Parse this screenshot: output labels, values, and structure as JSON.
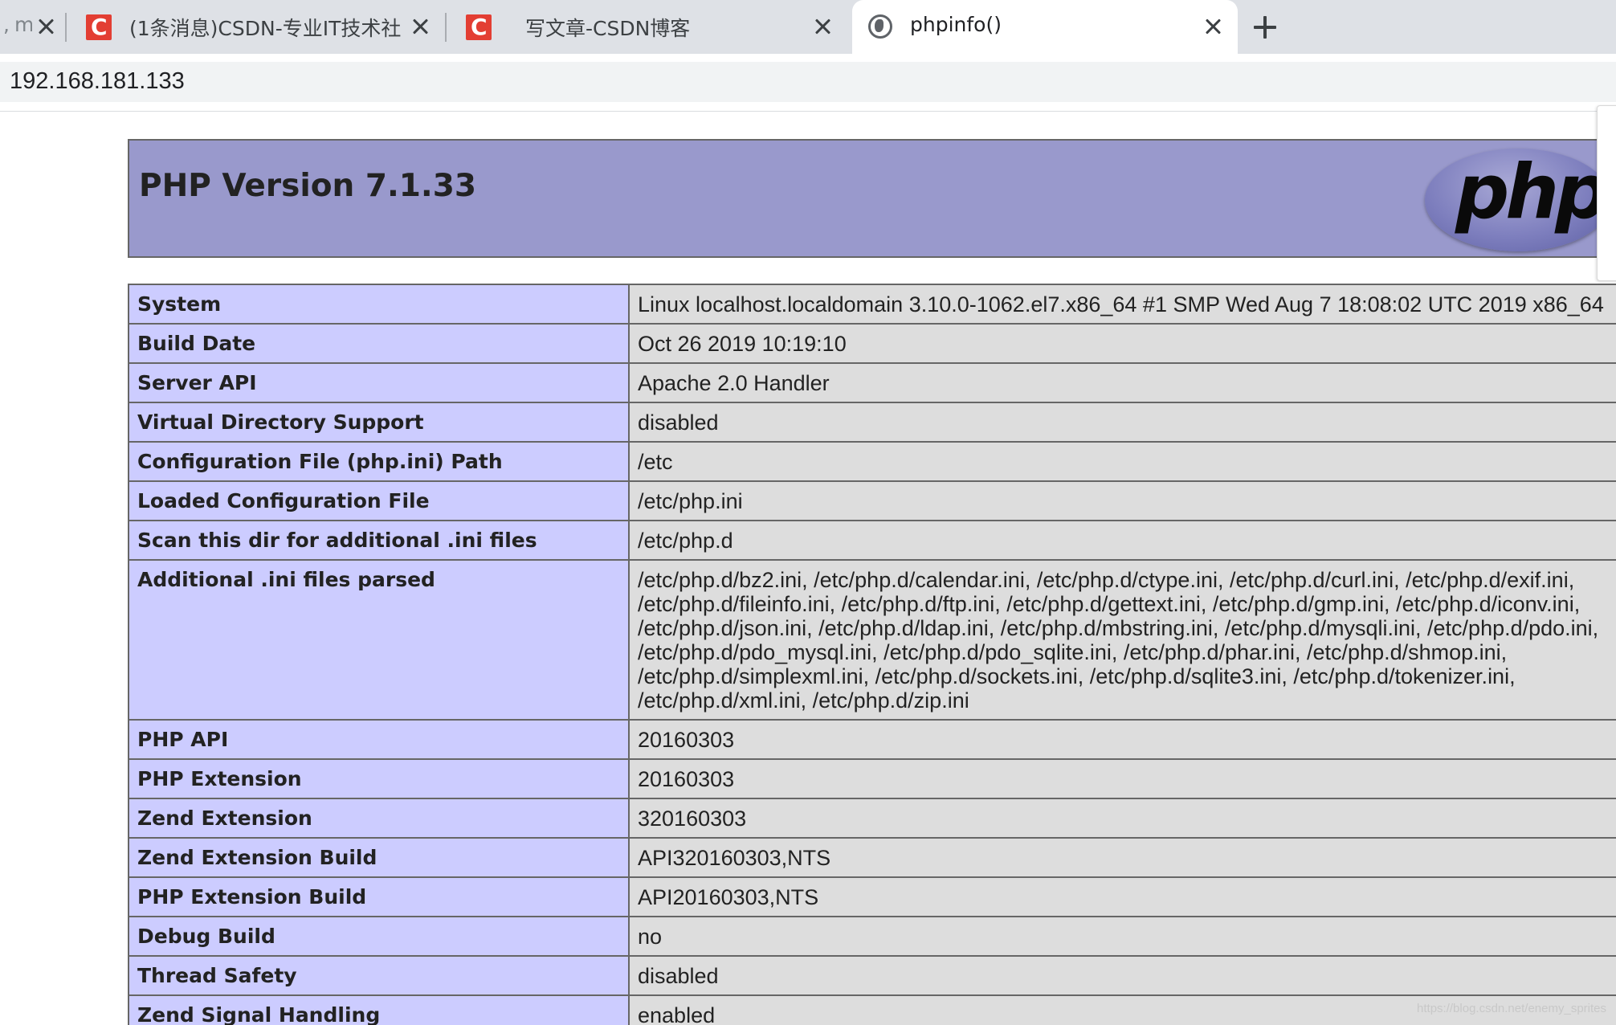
{
  "browser": {
    "tabs": [
      {
        "title": "ma",
        "active": false
      },
      {
        "title": "(1条消息)CSDN-专业IT技术社区",
        "active": false
      },
      {
        "title": "写文章-CSDN博客",
        "active": false
      },
      {
        "title": "phpinfo()",
        "active": true
      }
    ],
    "address": "192.168.181.133"
  },
  "page": {
    "title": "PHP Version 7.1.33",
    "logo_text": "php",
    "rows": [
      {
        "key": "System",
        "value": [
          "Linux localhost.localdomain 3.10.0-1062.el7.x86_64 #1 SMP Wed Aug 7 18:08:02 UTC 2019 x86_64"
        ]
      },
      {
        "key": "Build Date",
        "value": [
          "Oct 26 2019 10:19:10"
        ]
      },
      {
        "key": "Server API",
        "value": [
          "Apache 2.0 Handler"
        ]
      },
      {
        "key": "Virtual Directory Support",
        "value": [
          "disabled"
        ]
      },
      {
        "key": "Configuration File (php.ini) Path",
        "value": [
          "/etc"
        ]
      },
      {
        "key": "Loaded Configuration File",
        "value": [
          "/etc/php.ini"
        ]
      },
      {
        "key": "Scan this dir for additional .ini files",
        "value": [
          "/etc/php.d"
        ]
      },
      {
        "key": "Additional .ini files parsed",
        "value": [
          "/etc/php.d/bz2.ini, /etc/php.d/calendar.ini, /etc/php.d/ctype.ini, /etc/php.d/curl.ini, /etc/php.d/exif.ini,",
          "/etc/php.d/fileinfo.ini, /etc/php.d/ftp.ini, /etc/php.d/gettext.ini, /etc/php.d/gmp.ini, /etc/php.d/iconv.ini,",
          "/etc/php.d/json.ini, /etc/php.d/ldap.ini, /etc/php.d/mbstring.ini, /etc/php.d/mysqli.ini, /etc/php.d/pdo.ini,",
          "/etc/php.d/pdo_mysql.ini, /etc/php.d/pdo_sqlite.ini, /etc/php.d/phar.ini, /etc/php.d/shmop.ini,",
          "/etc/php.d/simplexml.ini, /etc/php.d/sockets.ini, /etc/php.d/sqlite3.ini, /etc/php.d/tokenizer.ini,",
          "/etc/php.d/xml.ini, /etc/php.d/zip.ini"
        ]
      },
      {
        "key": "PHP API",
        "value": [
          "20160303"
        ]
      },
      {
        "key": "PHP Extension",
        "value": [
          "20160303"
        ]
      },
      {
        "key": "Zend Extension",
        "value": [
          "320160303"
        ]
      },
      {
        "key": "Zend Extension Build",
        "value": [
          "API320160303,NTS"
        ]
      },
      {
        "key": "PHP Extension Build",
        "value": [
          "API20160303,NTS"
        ]
      },
      {
        "key": "Debug Build",
        "value": [
          "no"
        ]
      },
      {
        "key": "Thread Safety",
        "value": [
          "disabled"
        ]
      },
      {
        "key": "Zend Signal Handling",
        "value": [
          "enabled"
        ]
      }
    ]
  },
  "watermark": "https://blog.csdn.net/enemy_sprites",
  "colors": {
    "header_bg": "#9999cc",
    "key_cell_bg": "#ccccff",
    "value_cell_bg": "#dddddd",
    "csdn_red": "#e33e33",
    "tabstrip_bg": "#dee1e6"
  },
  "icons": {
    "csdn_favicon": "csdn-icon",
    "active_tab_favicon": "globe-icon",
    "close": "close-icon",
    "new_tab": "plus-icon"
  }
}
